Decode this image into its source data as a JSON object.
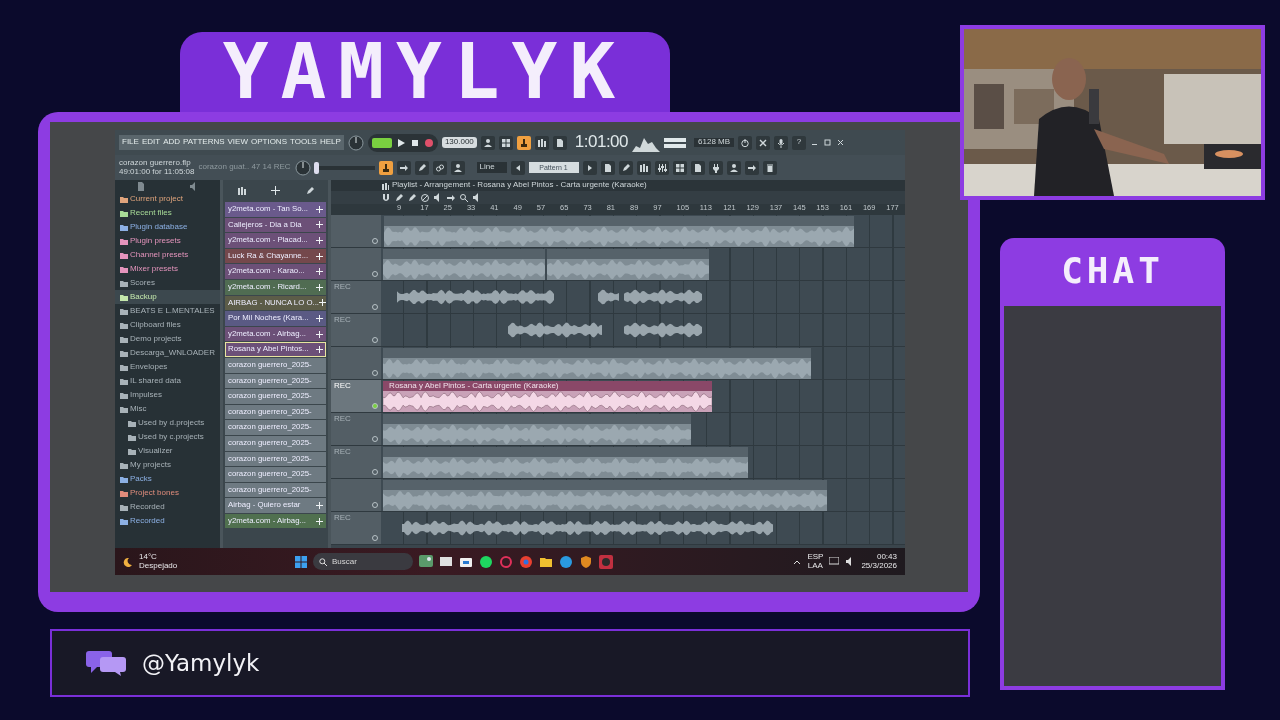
{
  "overlay": {
    "title": "YAMYLYK",
    "chat_title": "CHAT",
    "handle": "@Yamylyk"
  },
  "daw": {
    "menu": [
      "FILE",
      "EDIT",
      "ADD",
      "PATTERNS",
      "VIEW",
      "OPTIONS",
      "TOOLS",
      "HELP"
    ],
    "tempo": "130.000",
    "song_time": "1:01:00",
    "memory": "6128 MB",
    "help": "?",
    "project_name": "corazon guerrero.flp",
    "project_time": "49:01:00 for 11:05:08",
    "hint": "corazon guat.. 47 14 REC",
    "master_slider": {
      "level": 0.02
    },
    "snap": "Line",
    "pattern": "Pattern 1",
    "browser": [
      {
        "label": "Current project",
        "color": "#e0a47c",
        "selected": false
      },
      {
        "label": "Recent files",
        "color": "#a8dc98",
        "selected": false
      },
      {
        "label": "Plugin database",
        "color": "#8cb0e4",
        "selected": false
      },
      {
        "label": "Plugin presets",
        "color": "#e494bc",
        "selected": false
      },
      {
        "label": "Channel presets",
        "color": "#e494bc",
        "selected": false
      },
      {
        "label": "Mixer presets",
        "color": "#e494bc",
        "selected": false
      },
      {
        "label": "Scores",
        "color": "#a8b2b8",
        "selected": false
      },
      {
        "label": "Backup",
        "color": "#c4e8ac",
        "selected": true
      },
      {
        "label": "BEATS E L.MENTALES",
        "color": "#a8b2b8",
        "selected": false
      },
      {
        "label": "Clipboard files",
        "color": "#a8b2b8",
        "selected": false
      },
      {
        "label": "Demo projects",
        "color": "#a8b2b8",
        "selected": false
      },
      {
        "label": "Descarga_WNLOADER",
        "color": "#a8b2b8",
        "selected": false
      },
      {
        "label": "Envelopes",
        "color": "#a8b2b8",
        "selected": false
      },
      {
        "label": "IL shared data",
        "color": "#a8b2b8",
        "selected": false
      },
      {
        "label": "Impulses",
        "color": "#a8b2b8",
        "selected": false
      },
      {
        "label": "Misc",
        "color": "#a8b2b8",
        "selected": false,
        "children": [
          {
            "label": "Used by d.projects",
            "color": "#a8b2b8",
            "selected": false
          },
          {
            "label": "Used by c.projects",
            "color": "#a8b2b8",
            "selected": false
          },
          {
            "label": "Visualizer",
            "color": "#a8b2b8",
            "selected": false
          }
        ]
      },
      {
        "label": "My projects",
        "color": "#a8b2b8",
        "selected": false
      },
      {
        "label": "Packs",
        "color": "#8cb0e4",
        "selected": false
      },
      {
        "label": "Project bones",
        "color": "#e08c7c",
        "selected": false
      },
      {
        "label": "Recorded",
        "color": "#a8b2b8",
        "selected": false
      },
      {
        "label": "Recorded",
        "color": "#8cb0e4",
        "selected": false
      }
    ],
    "channels": [
      {
        "label": "y2meta.com - Tan So...",
        "kind": "sampler",
        "color": "#6a5a8c",
        "selected": false
      },
      {
        "label": "Callejeros - Dia a Dia",
        "kind": "sampler",
        "color": "#6c5078",
        "selected": false
      },
      {
        "label": "y2meta.com - Placad...",
        "kind": "sampler",
        "color": "#6c5078",
        "selected": false
      },
      {
        "label": "Luck Ra & Chayanne...",
        "kind": "sampler",
        "color": "#74484c",
        "selected": false
      },
      {
        "label": "y2meta.com - Karao...",
        "kind": "sampler",
        "color": "#6c5078",
        "selected": false
      },
      {
        "label": "y2meta.com - Ricard...",
        "kind": "sampler",
        "color": "#506c52",
        "selected": false
      },
      {
        "label": "AIRBAG - NUNCA LO O...",
        "kind": "sampler",
        "color": "#5c5c48",
        "selected": false
      },
      {
        "label": "Por Mil Noches (Kara...",
        "kind": "sampler",
        "color": "#5a5a84",
        "selected": false
      },
      {
        "label": "y2meta.com - Airbag...",
        "kind": "sampler",
        "color": "#6c5078",
        "selected": false
      },
      {
        "label": "Rosana y Abel Pintos...",
        "kind": "sampler",
        "color": "#6c5078",
        "selected": true
      },
      {
        "label": "corazon guerrero_2025-",
        "kind": "audio",
        "color": "#6e7a82",
        "selected": false
      },
      {
        "label": "corazon guerrero_2025-",
        "kind": "audio",
        "color": "#6e7a82",
        "selected": false
      },
      {
        "label": "corazon guerrero_2025-",
        "kind": "audio",
        "color": "#6e7a82",
        "selected": false
      },
      {
        "label": "corazon guerrero_2025-",
        "kind": "audio",
        "color": "#6e7a82",
        "selected": false
      },
      {
        "label": "corazon guerrero_2025-",
        "kind": "audio",
        "color": "#6e7a82",
        "selected": false
      },
      {
        "label": "corazon guerrero_2025-",
        "kind": "audio",
        "color": "#6e7a82",
        "selected": false
      },
      {
        "label": "corazon guerrero_2025-",
        "kind": "audio",
        "color": "#6e7a82",
        "selected": false
      },
      {
        "label": "corazon guerrero_2025-",
        "kind": "audio",
        "color": "#6e7a82",
        "selected": false
      },
      {
        "label": "corazon guerrero_2025-",
        "kind": "audio",
        "color": "#6e7a82",
        "selected": false
      },
      {
        "label": "Airbag - Quiero estar",
        "kind": "sampler",
        "color": "#6e7a82",
        "selected": false
      },
      {
        "label": "y2meta.com - Airbag...",
        "kind": "sampler",
        "color": "#50704f",
        "selected": false
      }
    ],
    "playlist": {
      "title": "Playlist - Arrangement - Rosana y Abel Pintos - Carta urgente (Karaoke)",
      "ruler": [
        "9",
        "17",
        "25",
        "33",
        "41",
        "49",
        "57",
        "65",
        "73",
        "81",
        "89",
        "97",
        "105",
        "113",
        "121",
        "129",
        "137",
        "145",
        "153",
        "161",
        "169",
        "177"
      ],
      "tracks": [
        {
          "selected": false,
          "clips": [
            {
              "kind": "audio",
              "selected": false
            }
          ]
        },
        {
          "selected": false,
          "clips": [
            {
              "kind": "audio",
              "selected": false
            },
            {
              "kind": "audio",
              "selected": false
            }
          ]
        },
        {
          "label": "REC",
          "selected": false,
          "clips": [
            {
              "kind": "slice",
              "selected": false
            },
            {
              "kind": "slice",
              "selected": false
            },
            {
              "kind": "slice",
              "selected": false
            }
          ]
        },
        {
          "label": "REC",
          "selected": false,
          "clips": [
            {
              "kind": "slice",
              "selected": false
            },
            {
              "kind": "slice",
              "selected": false
            }
          ]
        },
        {
          "selected": false,
          "clips": [
            {
              "kind": "audio",
              "selected": false
            }
          ]
        },
        {
          "label": "REC",
          "selected": true,
          "clips": [
            {
              "kind": "audio",
              "selected": true,
              "name": "Rosana y Abel Pintos - Carta urgente (Karaoke)"
            }
          ]
        },
        {
          "label": "REC",
          "selected": false,
          "clips": [
            {
              "kind": "audio",
              "selected": false
            }
          ]
        },
        {
          "label": "REC",
          "selected": false,
          "clips": [
            {
              "kind": "audio",
              "selected": false
            }
          ]
        },
        {
          "selected": false,
          "clips": [
            {
              "kind": "audio",
              "selected": false
            }
          ]
        },
        {
          "label": "REC",
          "selected": false,
          "clips": [
            {
              "kind": "slice",
              "selected": false
            }
          ]
        }
      ]
    }
  },
  "taskbar": {
    "temperature": "14°C",
    "weather": "Despejado",
    "search": {
      "placeholder": "Buscar"
    },
    "language": "ESP",
    "layout": "LAA",
    "time": "00:43",
    "date": "25/3/2026"
  }
}
